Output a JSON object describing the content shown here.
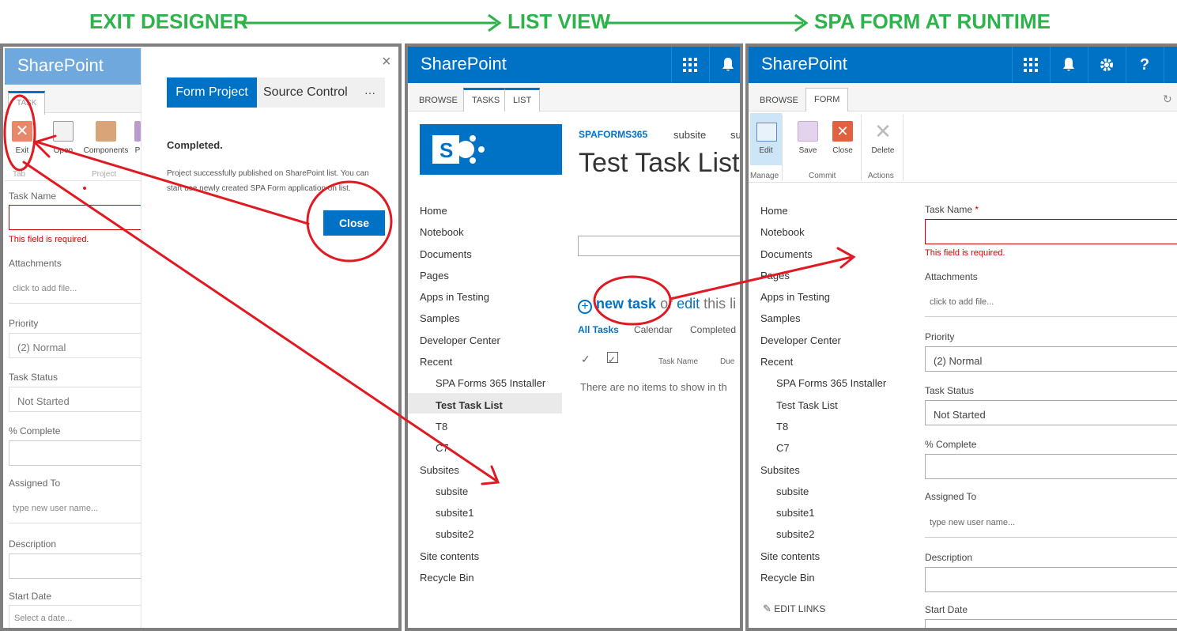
{
  "headers": {
    "exit_designer": "EXIT DESIGNER",
    "list_view": "LIST VIEW",
    "spa_form": "SPA FORM AT RUNTIME"
  },
  "colors": {
    "accent": "#0072c6",
    "green": "#2db34a",
    "annotation_red": "#e01a22"
  },
  "left_panel": {
    "brand": "SharePoint",
    "tab": "TASK",
    "ribbon": {
      "exit": "Exit",
      "open": "Open",
      "components": "Components",
      "partial": "P",
      "group_tab": "Tab",
      "group_project": "Project"
    },
    "fields": {
      "task_name": "Task Name",
      "error": "This field is required.",
      "attachments": "Attachments",
      "attach_ph": "click to add file...",
      "priority": "Priority",
      "priority_value": "(2) Normal",
      "task_status": "Task Status",
      "status_value": "Not Started",
      "complete": "% Complete",
      "assigned": "Assigned To",
      "assigned_ph": "type new user name...",
      "description": "Description",
      "start_date": "Start Date",
      "date_ph": "Select a date..."
    },
    "dialog": {
      "close_x": "×",
      "tab_active": "Form Project",
      "tab_other": "Source Control",
      "more": "···",
      "heading": "Completed.",
      "message_1": "Project successfully published on SharePoint list. You can",
      "message_2": "start use newly created SPA Form application on list.",
      "close_button": "Close"
    }
  },
  "middle_panel": {
    "brand": "SharePoint",
    "tabs": [
      "BROWSE",
      "TASKS",
      "LIST"
    ],
    "site_name": "SPAFORMS365",
    "sub_links": [
      "subsite",
      "su"
    ],
    "page_title": "Test Task List",
    "new_task": "new task",
    "or_edit": "or",
    "edit": "edit",
    "this_list": "this li",
    "views": [
      "All Tasks",
      "Calendar",
      "Completed"
    ],
    "columns": [
      "Task Name",
      "Due"
    ],
    "empty": "There are no items to show in th",
    "nav": [
      "Home",
      "Notebook",
      "Documents",
      "Pages",
      "Apps in Testing",
      "Samples",
      "Developer Center",
      "Recent"
    ],
    "recent": [
      "SPA Forms 365 Installer",
      "Test Task List",
      "T8",
      "C7"
    ],
    "subsites_label": "Subsites",
    "subsites": [
      "subsite",
      "subsite1",
      "subsite2"
    ],
    "bottom": [
      "Site contents",
      "Recycle Bin"
    ]
  },
  "right_panel": {
    "brand": "SharePoint",
    "tabs": [
      "BROWSE",
      "FORM"
    ],
    "ribbon": {
      "edit": "Edit",
      "save": "Save",
      "close": "Close",
      "delete": "Delete",
      "group_manage": "Manage",
      "group_commit": "Commit",
      "group_actions": "Actions"
    },
    "nav": [
      "Home",
      "Notebook",
      "Documents",
      "Pages",
      "Apps in Testing",
      "Samples",
      "Developer Center",
      "Recent"
    ],
    "recent": [
      "SPA Forms 365 Installer",
      "Test Task List",
      "T8",
      "C7"
    ],
    "subsites_label": "Subsites",
    "subsites": [
      "subsite",
      "subsite1",
      "subsite2"
    ],
    "bottom": [
      "Site contents",
      "Recycle Bin"
    ],
    "edit_links": "EDIT LINKS",
    "fields": {
      "task_name": "Task Name",
      "required_mark": "*",
      "error": "This field is required.",
      "attachments": "Attachments",
      "attach_ph": "click to add file...",
      "priority": "Priority",
      "priority_value": "(2) Normal",
      "task_status": "Task Status",
      "status_value": "Not Started",
      "complete": "% Complete",
      "assigned": "Assigned To",
      "assigned_ph": "type new user name...",
      "description": "Description",
      "start_date": "Start Date"
    }
  }
}
